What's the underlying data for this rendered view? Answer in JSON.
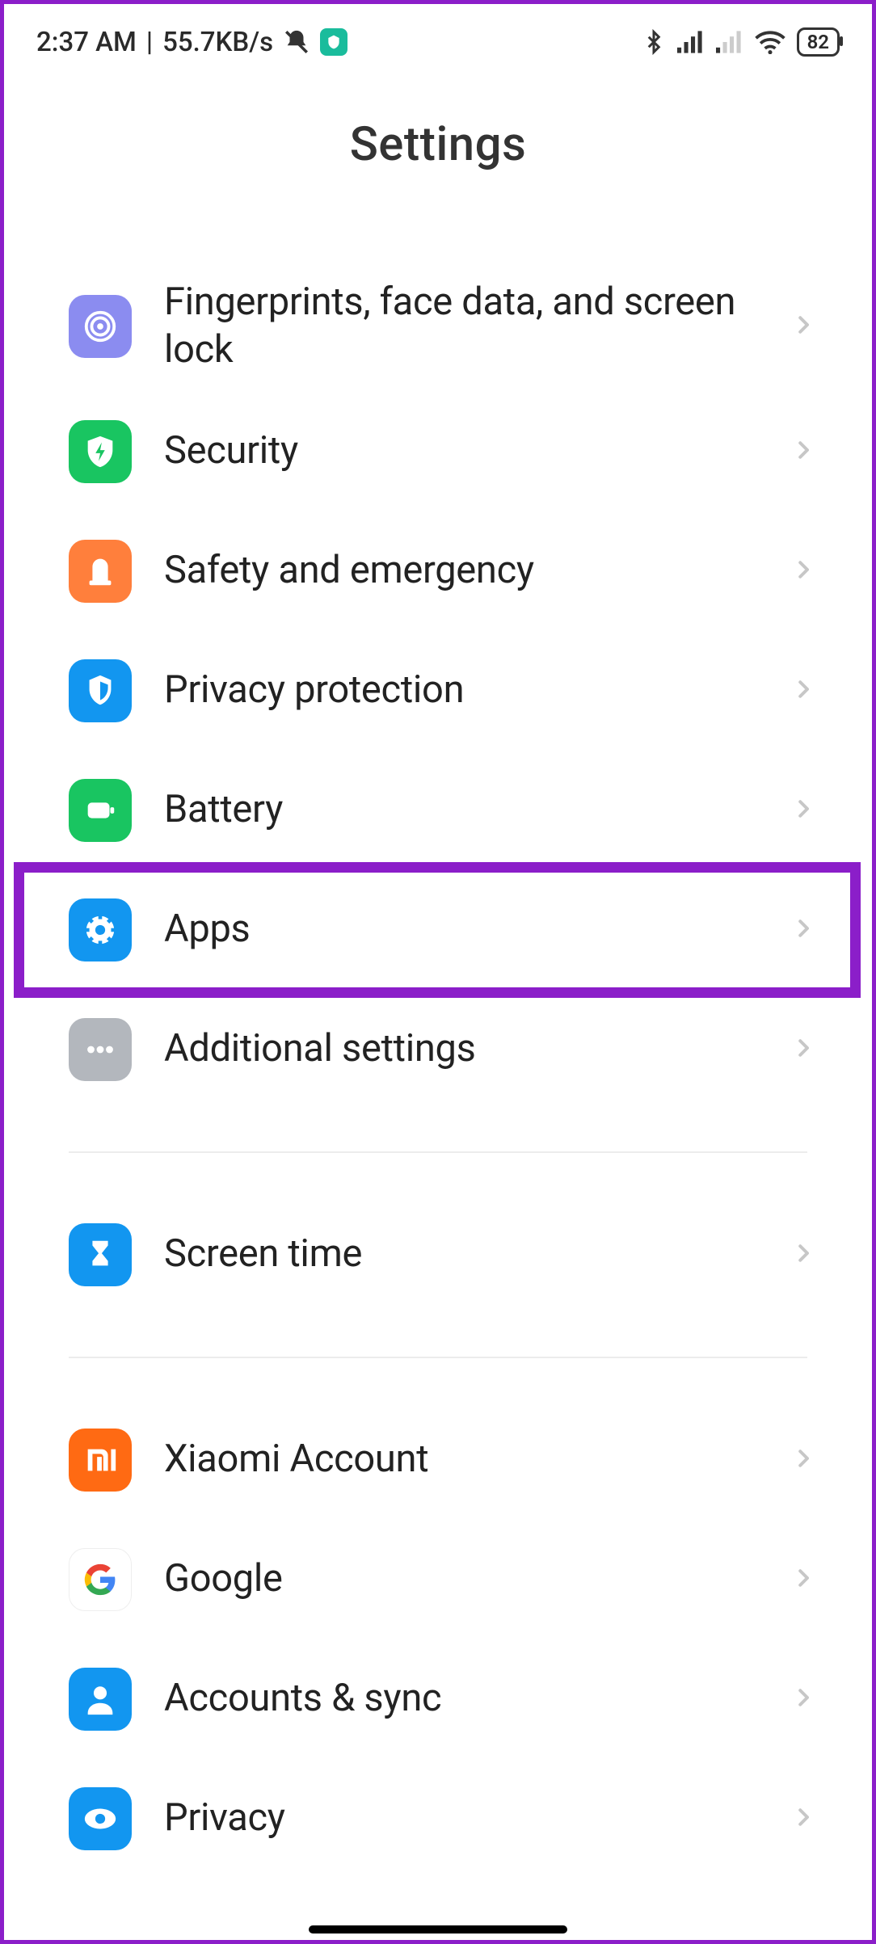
{
  "status": {
    "time": "2:37 AM",
    "net_speed": "55.7KB/s",
    "battery": "82"
  },
  "header": {
    "title": "Settings"
  },
  "groups": [
    {
      "items": [
        {
          "id": "fingerprints",
          "label": "Fingerprints, face data, and screen lock",
          "icon": "fingerprint-icon",
          "bg": "bg-violet"
        },
        {
          "id": "security",
          "label": "Security",
          "icon": "shield-bolt-icon",
          "bg": "bg-green"
        },
        {
          "id": "safety",
          "label": "Safety and emergency",
          "icon": "siren-icon",
          "bg": "bg-orange"
        },
        {
          "id": "privacy-protection",
          "label": "Privacy protection",
          "icon": "privacy-shield-icon",
          "bg": "bg-blue"
        },
        {
          "id": "battery",
          "label": "Battery",
          "icon": "battery-icon",
          "bg": "bg-green"
        },
        {
          "id": "apps",
          "label": "Apps",
          "icon": "gear-icon",
          "bg": "bg-blue",
          "highlighted": true
        },
        {
          "id": "additional",
          "label": "Additional settings",
          "icon": "more-icon",
          "bg": "bg-gray"
        }
      ]
    },
    {
      "items": [
        {
          "id": "screen-time",
          "label": "Screen time",
          "icon": "hourglass-icon",
          "bg": "bg-blue"
        }
      ]
    },
    {
      "items": [
        {
          "id": "xiaomi-account",
          "label": "Xiaomi Account",
          "icon": "mi-logo-icon",
          "bg": "bg-miorange"
        },
        {
          "id": "google",
          "label": "Google",
          "icon": "google-icon",
          "bg": "bg-white"
        },
        {
          "id": "accounts-sync",
          "label": "Accounts & sync",
          "icon": "person-icon",
          "bg": "bg-blue"
        },
        {
          "id": "privacy",
          "label": "Privacy",
          "icon": "eye-icon",
          "bg": "bg-blue"
        }
      ]
    }
  ]
}
